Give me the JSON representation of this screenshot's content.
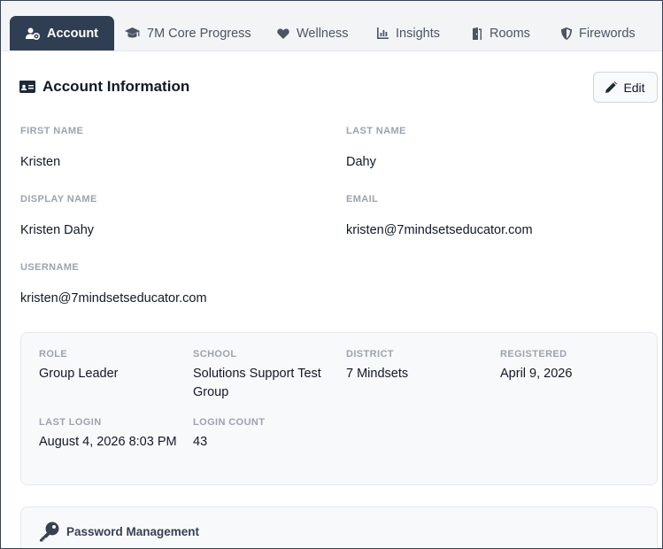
{
  "tabs": [
    {
      "label": "Account",
      "icon": "user-gear-icon",
      "active": true
    },
    {
      "label": "7M Core Progress",
      "icon": "graduation-cap-icon"
    },
    {
      "label": "Wellness",
      "icon": "heart-icon"
    },
    {
      "label": "Insights",
      "icon": "chart-icon"
    },
    {
      "label": "Rooms",
      "icon": "door-icon"
    },
    {
      "label": "Firewords",
      "icon": "shield-icon"
    }
  ],
  "account": {
    "title": "Account Information",
    "edit_label": "Edit",
    "fields": {
      "first_name": {
        "label": "First Name",
        "value": "Kristen"
      },
      "last_name": {
        "label": "Last Name",
        "value": "Dahy"
      },
      "display_name": {
        "label": "Display Name",
        "value": "Kristen Dahy"
      },
      "email": {
        "label": "Email",
        "value": "kristen@7mindsetseducator.com"
      },
      "username": {
        "label": "Username",
        "value": "kristen@7mindsetseducator.com"
      }
    }
  },
  "details": {
    "role": {
      "label": "Role",
      "value": "Group Leader"
    },
    "school": {
      "label": "School",
      "value": "Solutions Support Test Group"
    },
    "district": {
      "label": "District",
      "value": "7 Mindsets"
    },
    "registered": {
      "label": "Registered",
      "value": "April 9, 2026"
    },
    "last_login": {
      "label": "Last Login",
      "value": "August 4, 2026 8:03 PM"
    },
    "login_count": {
      "label": "Login Count",
      "value": "43"
    }
  },
  "password": {
    "title": "Password Management"
  },
  "colors": {
    "active_tab": "#2f3e52",
    "tabbar_bg": "#f3f4f6",
    "label_gray": "#9ca3af"
  }
}
